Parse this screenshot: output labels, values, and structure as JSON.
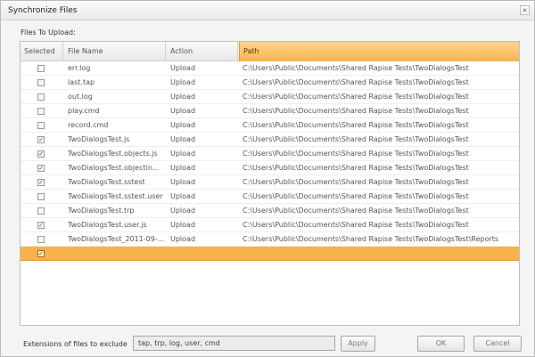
{
  "window": {
    "title": "Synchronize Files",
    "close_label": "×"
  },
  "grid": {
    "label": "Files To Upload:",
    "columns": [
      "Selected",
      "File Name",
      "Action",
      "Path"
    ],
    "rows": [
      {
        "selected": false,
        "file": "err.log",
        "action": "Upload",
        "path": "C:\\Users\\Public\\Documents\\Shared Rapise Tests\\TwoDialogsTest"
      },
      {
        "selected": false,
        "file": "last.tap",
        "action": "Upload",
        "path": "C:\\Users\\Public\\Documents\\Shared Rapise Tests\\TwoDialogsTest"
      },
      {
        "selected": false,
        "file": "out.log",
        "action": "Upload",
        "path": "C:\\Users\\Public\\Documents\\Shared Rapise Tests\\TwoDialogsTest"
      },
      {
        "selected": false,
        "file": "play.cmd",
        "action": "Upload",
        "path": "C:\\Users\\Public\\Documents\\Shared Rapise Tests\\TwoDialogsTest"
      },
      {
        "selected": false,
        "file": "record.cmd",
        "action": "Upload",
        "path": "C:\\Users\\Public\\Documents\\Shared Rapise Tests\\TwoDialogsTest"
      },
      {
        "selected": true,
        "file": "TwoDialogsTest.js",
        "action": "Upload",
        "path": "C:\\Users\\Public\\Documents\\Shared Rapise Tests\\TwoDialogsTest"
      },
      {
        "selected": true,
        "file": "TwoDialogsTest.objects.js",
        "action": "Upload",
        "path": "C:\\Users\\Public\\Documents\\Shared Rapise Tests\\TwoDialogsTest"
      },
      {
        "selected": true,
        "file": "TwoDialogsTest.objectin...",
        "action": "Upload",
        "path": "C:\\Users\\Public\\Documents\\Shared Rapise Tests\\TwoDialogsTest"
      },
      {
        "selected": true,
        "file": "TwoDialogsTest.sstest",
        "action": "Upload",
        "path": "C:\\Users\\Public\\Documents\\Shared Rapise Tests\\TwoDialogsTest"
      },
      {
        "selected": false,
        "file": "TwoDialogsTest.sstest.user",
        "action": "Upload",
        "path": "C:\\Users\\Public\\Documents\\Shared Rapise Tests\\TwoDialogsTest"
      },
      {
        "selected": false,
        "file": "TwoDialogsTest.trp",
        "action": "Upload",
        "path": "C:\\Users\\Public\\Documents\\Shared Rapise Tests\\TwoDialogsTest"
      },
      {
        "selected": true,
        "file": "TwoDialogsTest.user.js",
        "action": "Upload",
        "path": "C:\\Users\\Public\\Documents\\Shared Rapise Tests\\TwoDialogsTest"
      },
      {
        "selected": false,
        "file": "TwoDialogsTest_2011-09-...",
        "action": "Upload",
        "path": "C:\\Users\\Public\\Documents\\Shared Rapise Tests\\TwoDialogsTest\\Reports"
      },
      {
        "selected": true,
        "file": "",
        "action": "",
        "path": "",
        "highlighted": true
      }
    ]
  },
  "footer": {
    "exclude_label": "Extensions of files to exclude",
    "exclude_value": "tap, trp, log, user, cmd",
    "apply_label": "Apply",
    "ok_label": "OK",
    "cancel_label": "Cancel"
  },
  "colors": {
    "accent": "#f8b24c",
    "accent_light": "#ffd68e"
  }
}
